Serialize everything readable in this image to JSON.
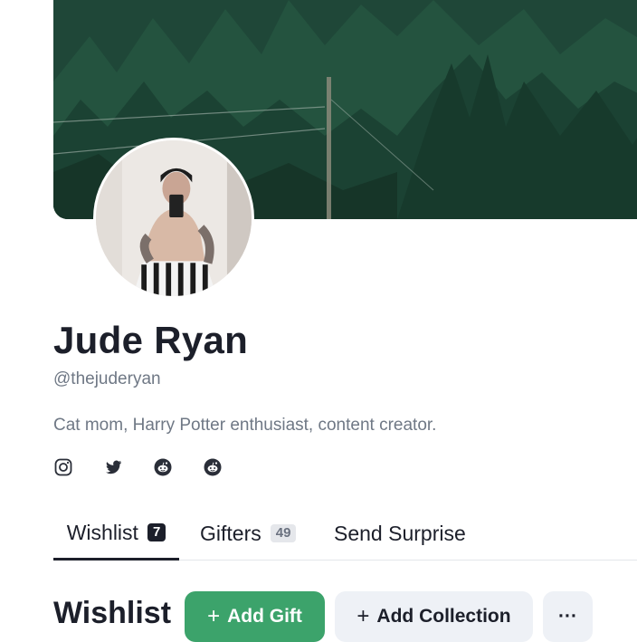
{
  "profile": {
    "name": "Jude Ryan",
    "handle": "@thejuderyan",
    "bio": "Cat mom, Harry Potter enthusiast, content creator."
  },
  "socials": [
    {
      "icon": "instagram-icon"
    },
    {
      "icon": "twitter-icon"
    },
    {
      "icon": "reddit-icon"
    },
    {
      "icon": "reddit-icon"
    }
  ],
  "tabs": {
    "wishlist": {
      "label": "Wishlist",
      "count": "7"
    },
    "gifters": {
      "label": "Gifters",
      "count": "49"
    },
    "surprise": {
      "label": "Send Surprise"
    }
  },
  "section": {
    "title": "Wishlist",
    "add_gift_label": "Add Gift",
    "add_collection_label": "Add Collection",
    "more_label": "···"
  },
  "colors": {
    "primary_green": "#3ca36b",
    "text_dark": "#1c1f2a",
    "muted": "#6f7885",
    "button_light": "#eef1f6"
  }
}
